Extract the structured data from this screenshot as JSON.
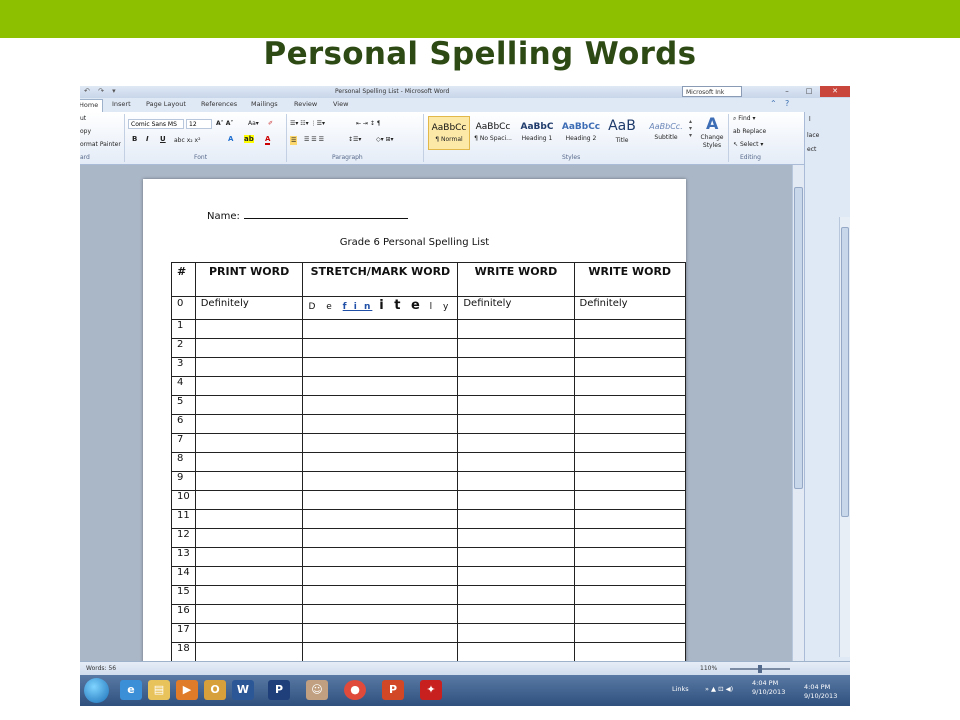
{
  "slide": {
    "title": "Personal Spelling Words",
    "bar_color": "#8dc100",
    "title_color": "#2e4a14"
  },
  "window": {
    "title": "Personal Spelling List - Microsoft Word",
    "ink_box": "Microsoft Ink",
    "buttons": [
      "–",
      "□",
      "✕"
    ]
  },
  "tabs": [
    "Home",
    "Insert",
    "Page Layout",
    "References",
    "Mailings",
    "Review",
    "View"
  ],
  "active_tab": "Home",
  "ribbon": {
    "clipboard": {
      "cut": "ut",
      "copy": "opy",
      "format_painter": "ormat Painter",
      "label": "ard"
    },
    "font": {
      "name": "Comic Sans MS",
      "size": "12",
      "label": "Font"
    },
    "paragraph": {
      "label": "Paragraph"
    },
    "styles": {
      "label": "Styles",
      "items": [
        {
          "sample": "AaBbCc",
          "name": "¶ Normal"
        },
        {
          "sample": "AaBbCc",
          "name": "¶ No Spaci..."
        },
        {
          "sample": "AaBbC",
          "name": "Heading 1"
        },
        {
          "sample": "AaBbCc",
          "name": "Heading 2"
        },
        {
          "sample": "AaB",
          "name": "Title"
        },
        {
          "sample": "AaBbCc.",
          "name": "Subtitle"
        }
      ],
      "change_styles": "Change Styles"
    },
    "editing": {
      "find": "Find",
      "replace": "Replace",
      "select": "Select",
      "label": "Editing"
    },
    "right_pane": {
      "l": "l",
      "place": "lace",
      "ect": "ect"
    }
  },
  "document": {
    "name_label": "Name:",
    "heading": "Grade 6 Personal Spelling List",
    "columns": [
      "#",
      "PRINT WORD",
      "STRETCH/MARK WORD",
      "WRITE WORD",
      "WRITE WORD"
    ],
    "example_row": {
      "num": "0",
      "print": "Definitely",
      "stretch": {
        "a": "D e",
        "fin": "f i n",
        "big": "i t e",
        "end": "l y"
      },
      "write1": "Definitely",
      "write2": "Definitely"
    },
    "row_numbers": [
      "1",
      "2",
      "3",
      "4",
      "5",
      "6",
      "7",
      "8",
      "9",
      "10",
      "11",
      "12",
      "13",
      "14",
      "15",
      "16",
      "17",
      "18"
    ]
  },
  "status": {
    "words": "Words: 56",
    "zoom": "110%"
  },
  "taskbar": {
    "links": "Links",
    "time": "4:04 PM",
    "date": "9/10/2013",
    "time2": "4:04 PM",
    "date2": "9/10/2013"
  }
}
